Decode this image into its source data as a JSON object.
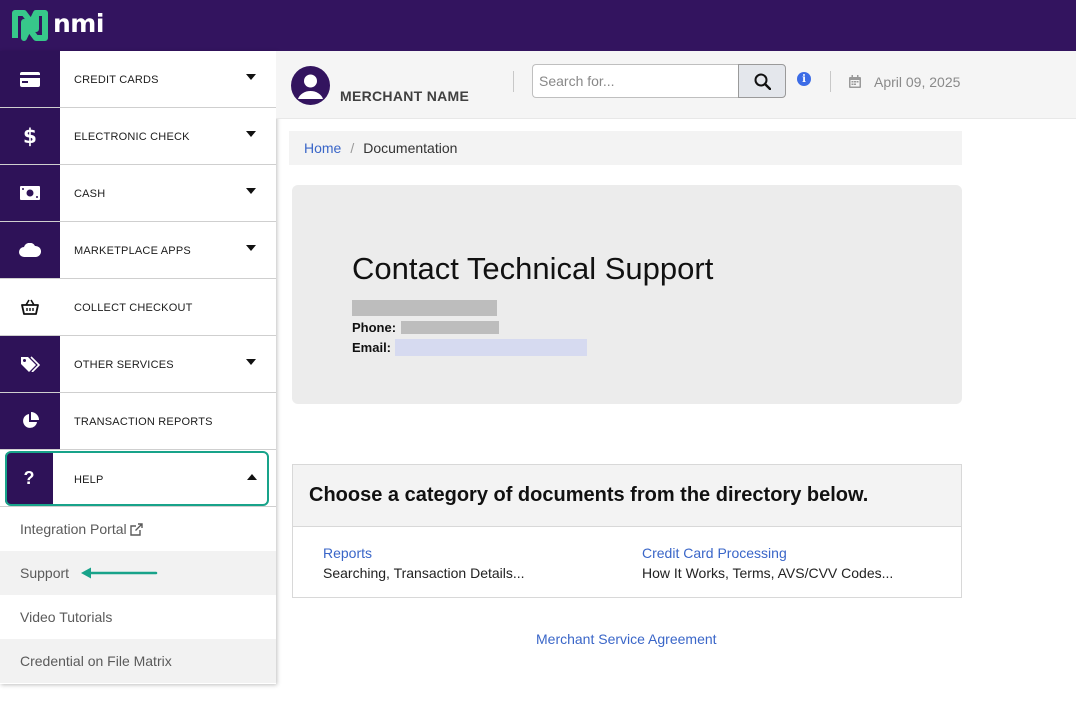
{
  "brand": {
    "logo_text": "nmi",
    "topbar_color": "#33145f",
    "accent_color": "#18a38a",
    "link_color": "#3a66c8"
  },
  "sidebar": {
    "items": [
      {
        "label": "CREDIT CARDS",
        "icon": "credit-card-icon",
        "dropdown": true
      },
      {
        "label": "ELECTRONIC CHECK",
        "icon": "dollar-icon",
        "dropdown": true
      },
      {
        "label": "CASH",
        "icon": "cash-icon",
        "dropdown": true
      },
      {
        "label": "MARKETPLACE APPS",
        "icon": "cloud-icon",
        "dropdown": true
      },
      {
        "label": "COLLECT CHECKOUT",
        "icon": "basket-icon",
        "dropdown": false
      },
      {
        "label": "OTHER SERVICES",
        "icon": "tags-icon",
        "dropdown": true
      },
      {
        "label": "TRANSACTION REPORTS",
        "icon": "pie-chart-icon",
        "dropdown": false
      },
      {
        "label": "HELP",
        "icon": "question-icon",
        "dropdown": true,
        "expanded": true
      }
    ],
    "help_subitems": [
      {
        "label": "Integration Portal",
        "external": true
      },
      {
        "label": "Support"
      },
      {
        "label": "Video Tutorials"
      },
      {
        "label": "Credential on File Matrix"
      }
    ]
  },
  "header": {
    "merchant_name": "MERCHANT NAME",
    "search_placeholder": "Search for...",
    "date": "April 09, 2025"
  },
  "breadcrumb": {
    "home": "Home",
    "separator": "/",
    "current": "Documentation"
  },
  "support": {
    "title": "Contact Technical Support",
    "phone_label": "Phone:",
    "email_label": "Email:"
  },
  "directory": {
    "heading": "Choose a category of documents from the directory below.",
    "categories": [
      {
        "title": "Reports",
        "description": "Searching, Transaction Details..."
      },
      {
        "title": "Credit Card Processing",
        "description": "How It Works, Terms, AVS/CVV Codes..."
      }
    ]
  },
  "footer": {
    "agreement_link": "Merchant Service Agreement"
  }
}
